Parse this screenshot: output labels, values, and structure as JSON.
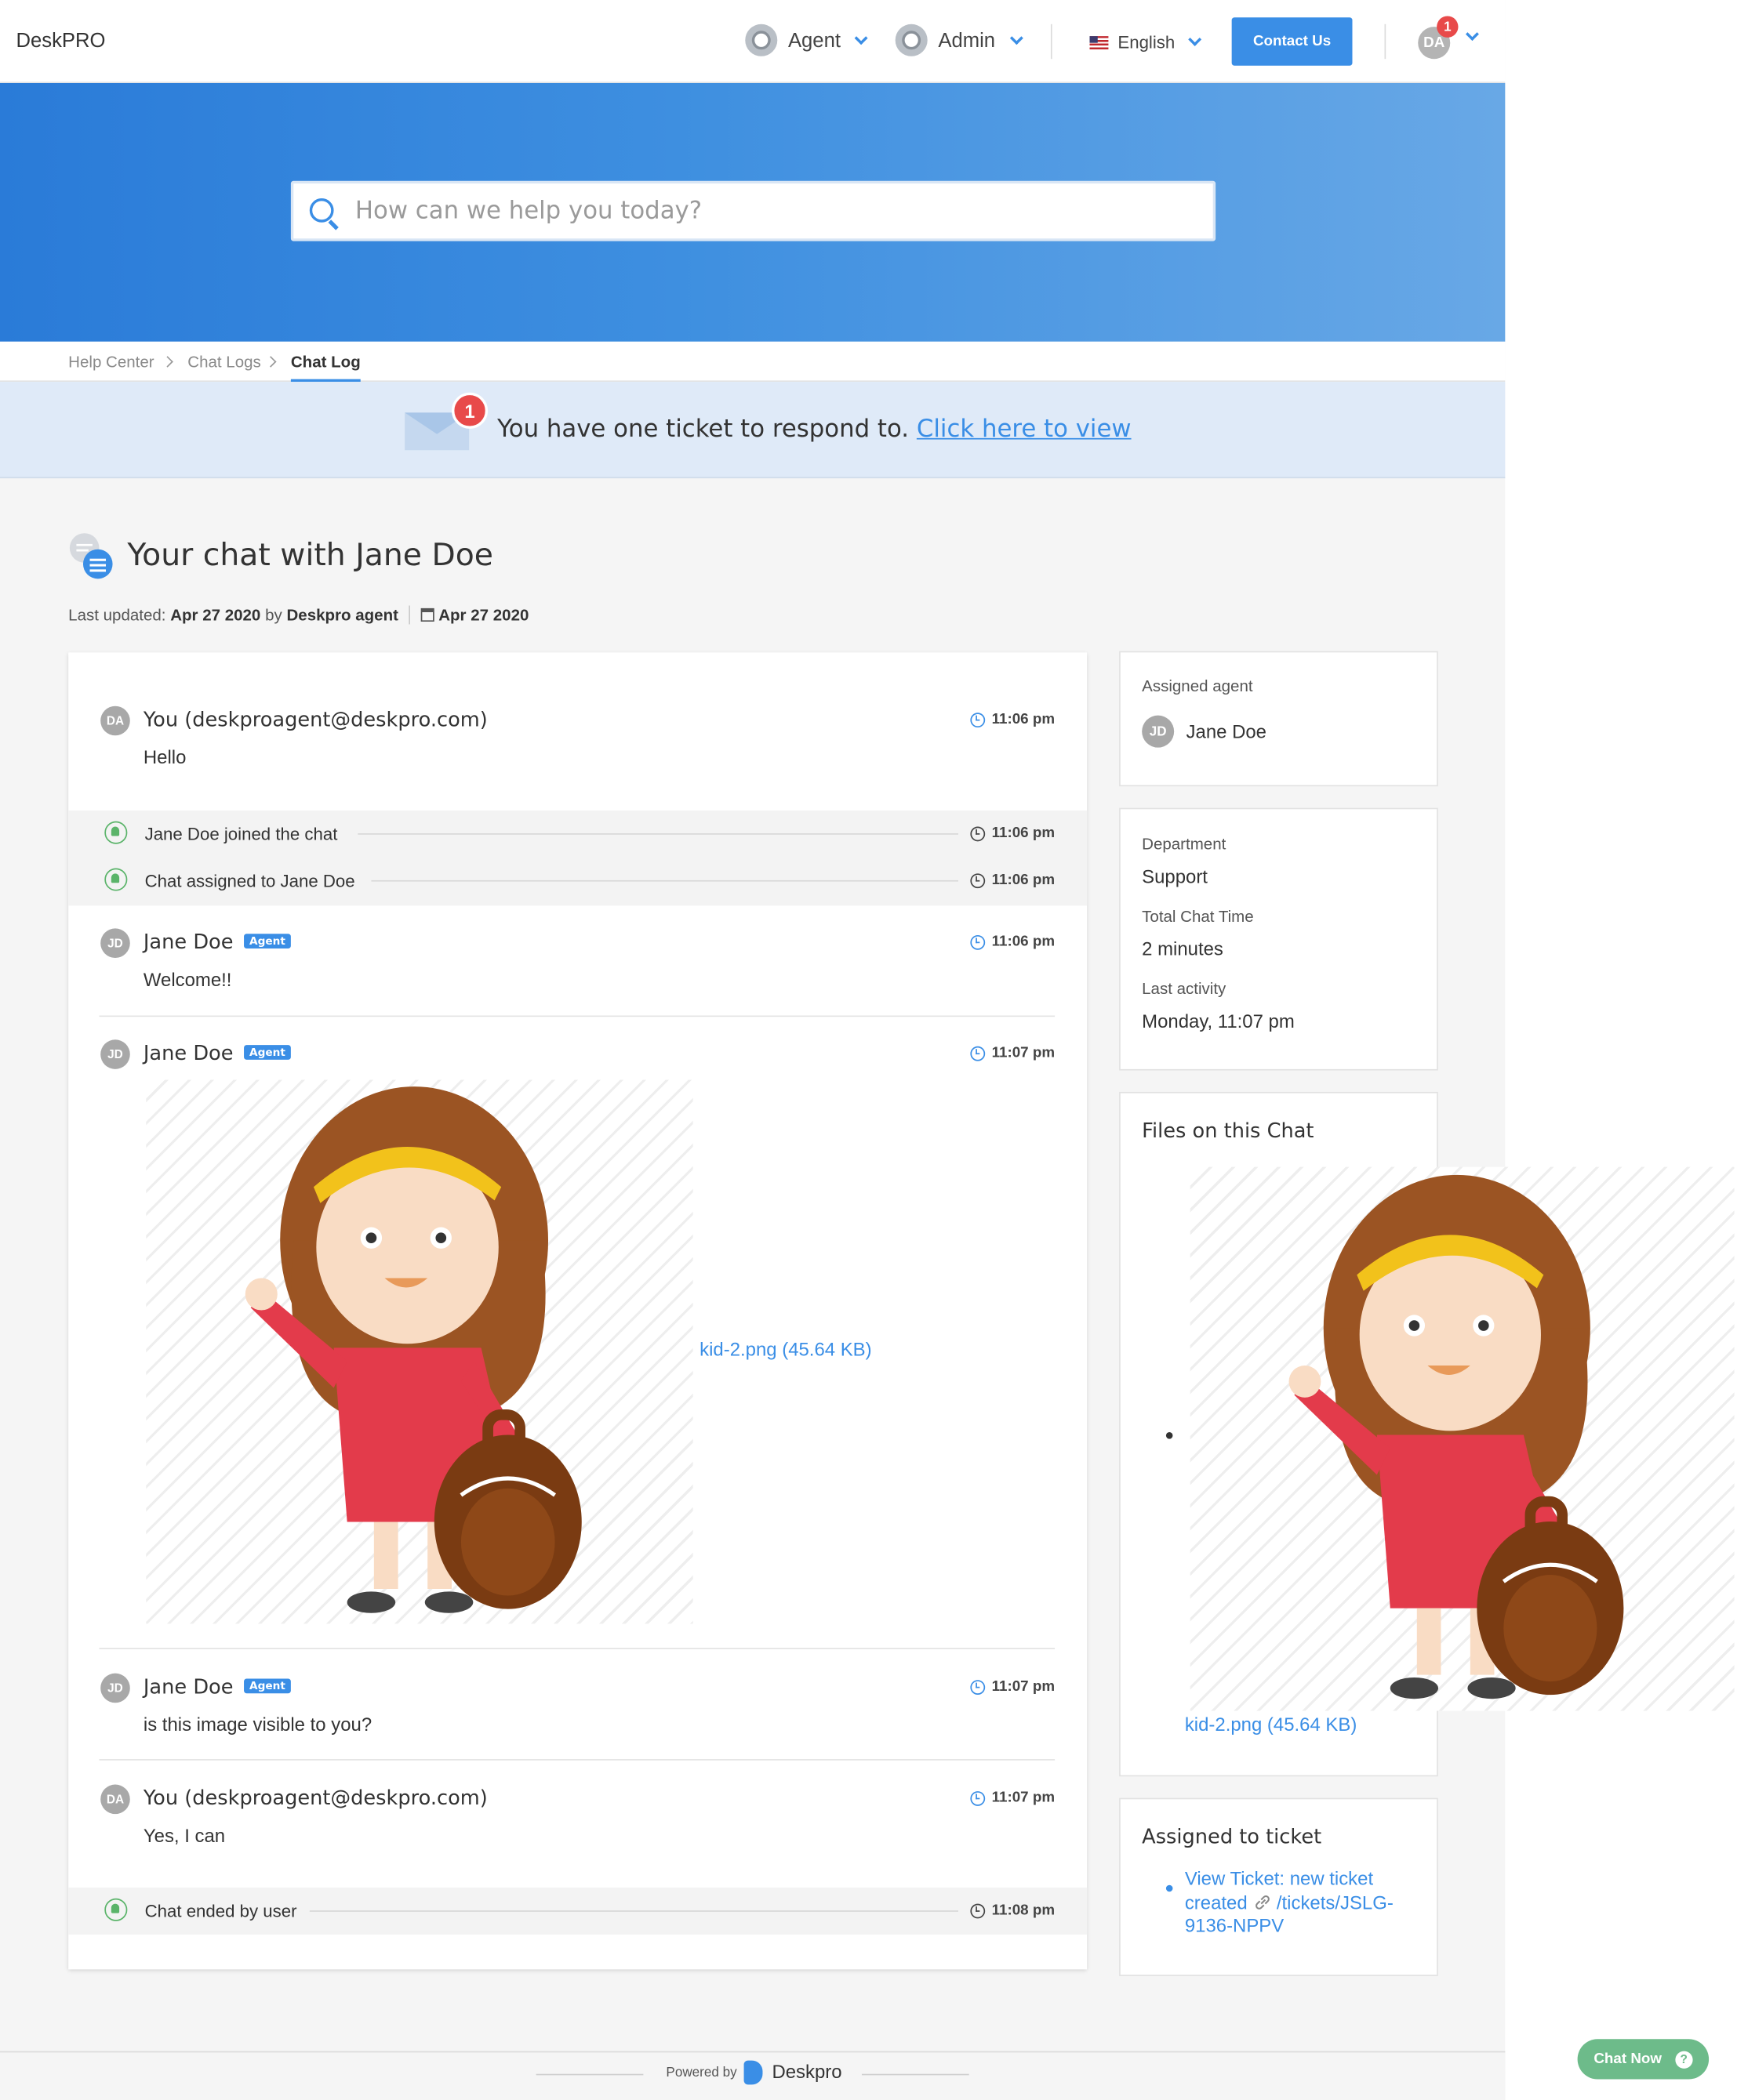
{
  "header": {
    "logo": "DeskPRO",
    "agent_label": "Agent",
    "admin_label": "Admin",
    "language": "English",
    "contact_label": "Contact Us",
    "user_initials": "DA",
    "user_badge": "1"
  },
  "search": {
    "placeholder": "How can we help you today?"
  },
  "breadcrumb": [
    "Help Center",
    "Chat Logs",
    "Chat Log"
  ],
  "notice": {
    "badge": "1",
    "text": "You have one ticket to respond to.",
    "link": "Click here to view"
  },
  "page": {
    "title": "Your chat with Jane Doe",
    "updated_label": "Last updated:",
    "updated_date": "Apr 27 2020",
    "by_label": "by",
    "updated_by": "Deskpro agent",
    "created_date": "Apr 27 2020"
  },
  "chat": {
    "agent_tag": "Agent",
    "messages": [
      {
        "initials": "DA",
        "sender": "You (deskproagent@deskpro.com)",
        "text": "Hello",
        "time": "11:06 pm"
      },
      {
        "system": "Jane Doe joined the chat",
        "time": "11:06 pm"
      },
      {
        "system": "Chat assigned to Jane Doe",
        "time": "11:06 pm"
      },
      {
        "initials": "JD",
        "sender": "Jane Doe",
        "text": "Welcome!!",
        "time": "11:06 pm"
      },
      {
        "initials": "JD",
        "sender": "Jane Doe",
        "file": "kid-2.png (45.64 KB)",
        "time": "11:07 pm"
      },
      {
        "initials": "JD",
        "sender": "Jane Doe",
        "text": "is this image visible to you?",
        "time": "11:07 pm"
      },
      {
        "initials": "DA",
        "sender": "You (deskproagent@deskpro.com)",
        "text": "Yes, I can",
        "time": "11:07 pm"
      },
      {
        "system": "Chat ended by user",
        "time": "11:08 pm"
      }
    ]
  },
  "sidebar": {
    "assigned_agent_label": "Assigned agent",
    "agent_initials": "JD",
    "agent_name": "Jane Doe",
    "department_label": "Department",
    "department": "Support",
    "total_time_label": "Total Chat Time",
    "total_time": "2 minutes",
    "last_activity_label": "Last activity",
    "last_activity": "Monday, 11:07 pm",
    "files_title": "Files on this Chat",
    "file_name": "kid-2.png (45.64 KB)",
    "ticket_title": "Assigned to ticket",
    "ticket_link_1": "View Ticket: new ticket",
    "ticket_link_2": "created",
    "ticket_link_3": "/tickets/JSLG-",
    "ticket_link_4": "9136-NPPV"
  },
  "footer": {
    "powered_by": "Powered by",
    "brand": "Deskpro"
  },
  "chat_widget": {
    "label": "Chat Now"
  },
  "colors": {
    "accent": "#3a8ee6",
    "hero_start": "#2a7bd8",
    "hero_end": "#68a8e6",
    "badge": "#e84a4a",
    "system": "#5bb46a",
    "chat_now": "#6dbb8a"
  }
}
